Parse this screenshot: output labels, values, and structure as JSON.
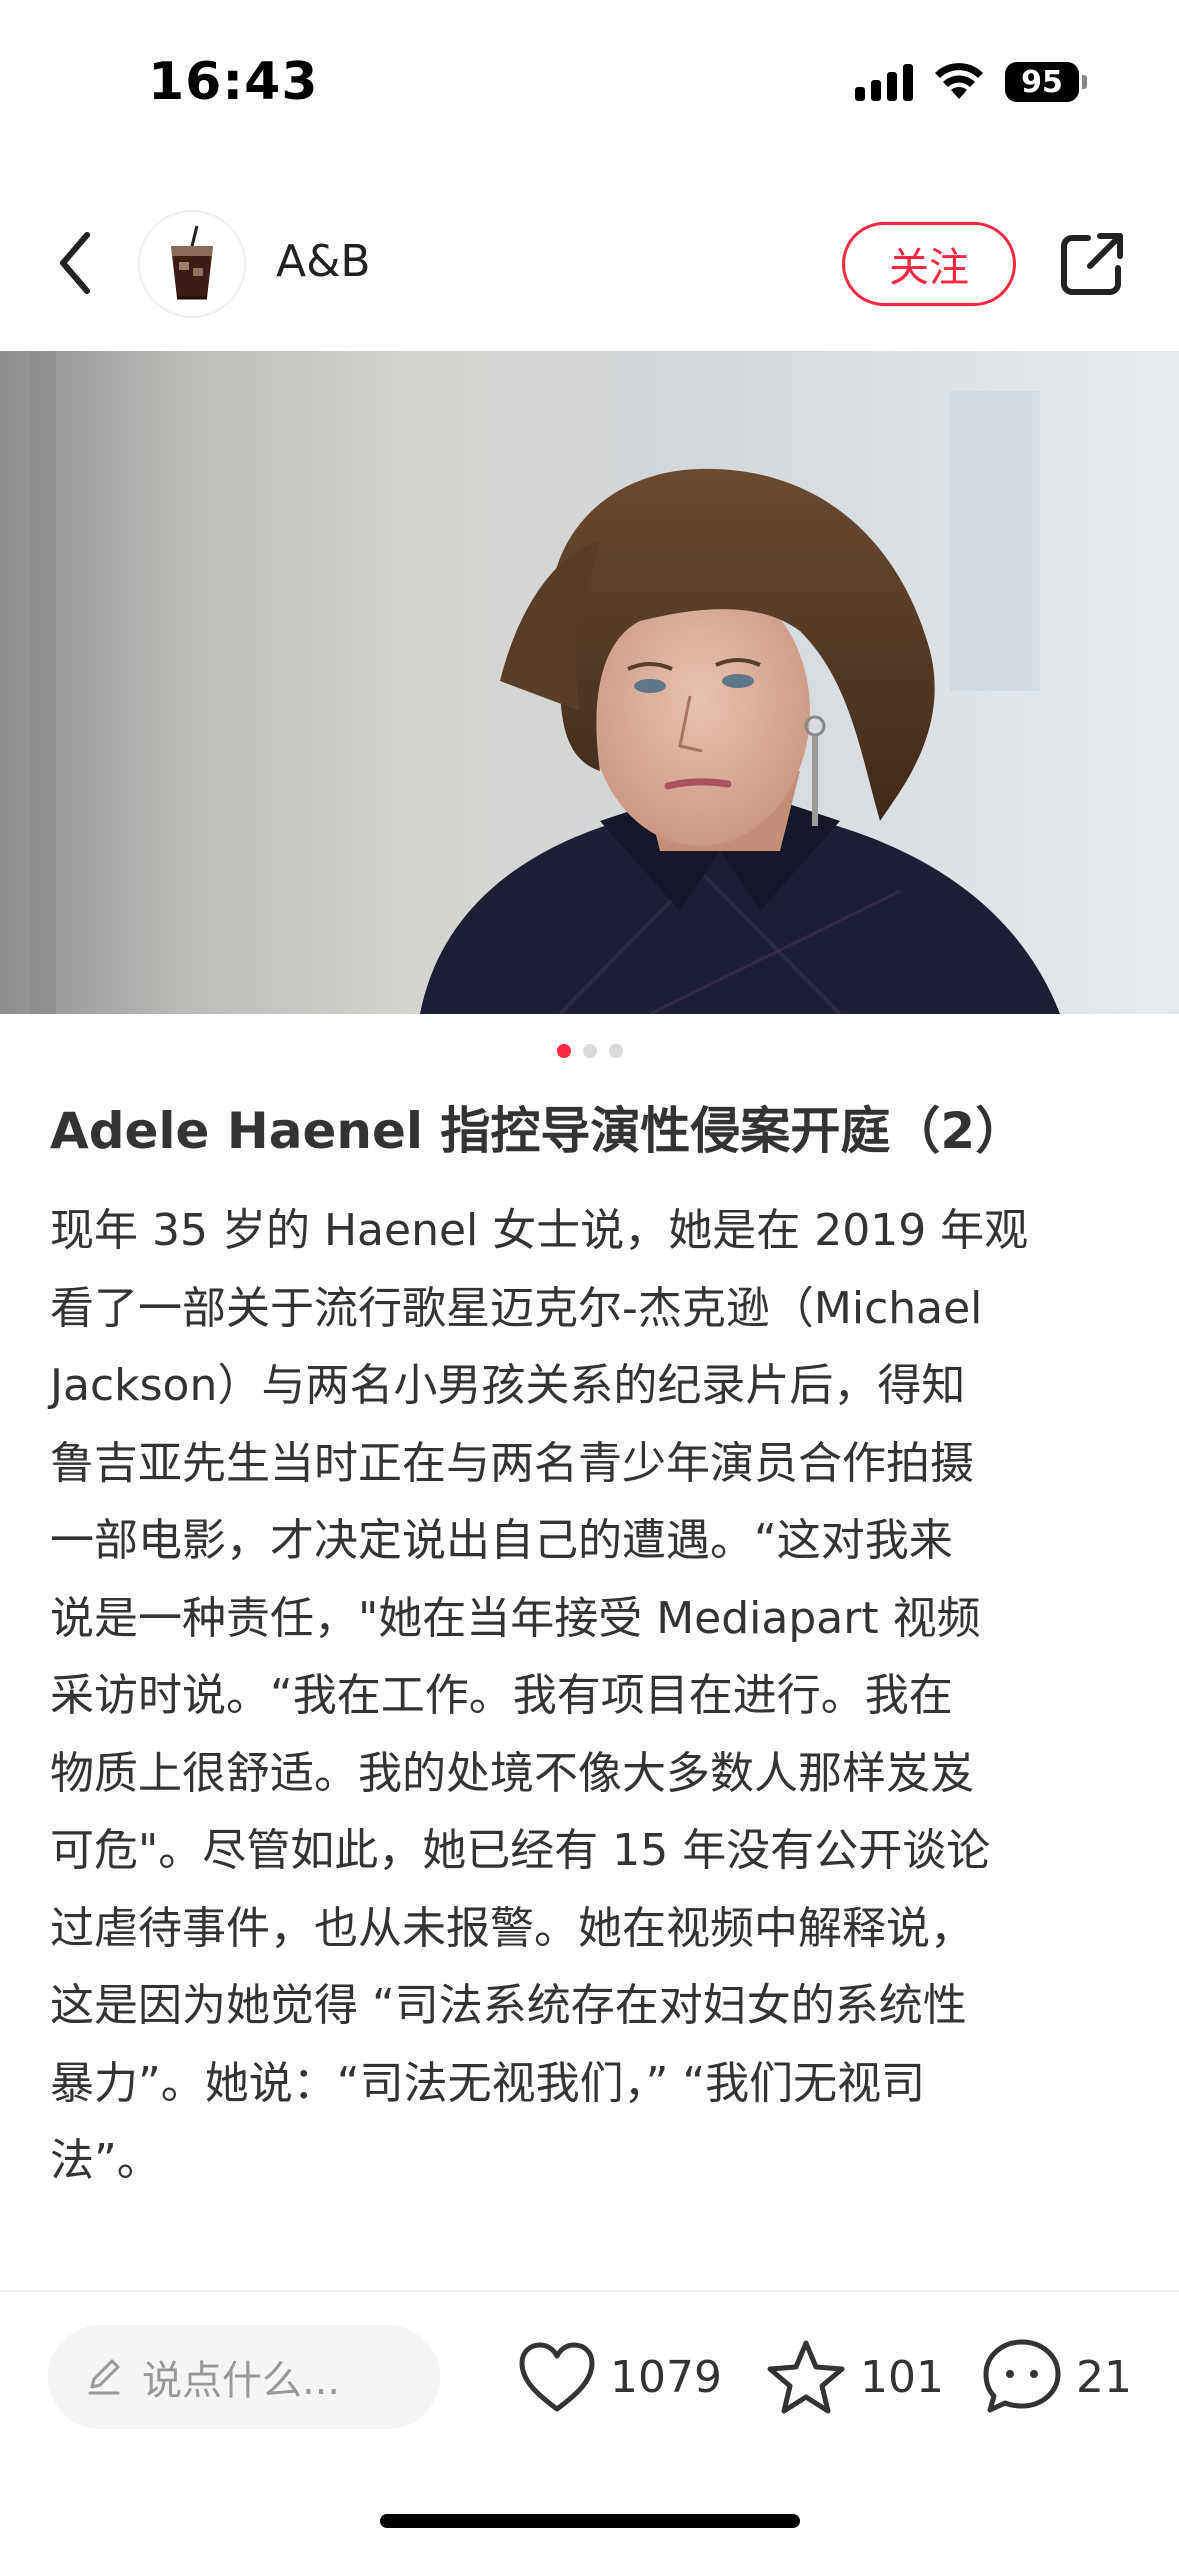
{
  "status_bar": {
    "time": "16:43",
    "battery": "95"
  },
  "header": {
    "author": "A&B",
    "follow_label": "关注",
    "icons": [
      "back-chevron-icon",
      "avatar-iced-drink",
      "share-icon"
    ]
  },
  "post": {
    "image_count": 3,
    "active_image_index": 0,
    "title": "Adele Haenel 指控导演性侵案开庭（2）",
    "body_lines": [
      "现年 35 岁的 Haenel 女士说，她是在 2019 年观",
      "看了一部关于流行歌星迈克尔-杰克逊（Michael",
      "Jackson）与两名小男孩关系的纪录片后，得知",
      "鲁吉亚先生当时正在与两名青少年演员合作拍摄",
      "一部电影，才决定说出自己的遭遇。“这对我来",
      "说是一种责任，\"她在当年接受 Mediapart 视频",
      "采访时说。“我在工作。我有项目在进行。我在",
      "物质上很舒适。我的处境不像大多数人那样岌岌",
      "可危\"。尽管如此，她已经有 15 年没有公开谈论",
      "过虐待事件，也从未报警。她在视频中解释说，",
      "这是因为她觉得 “司法系统存在对妇女的系统性",
      "暴力”。她说：“司法无视我们，” “我们无视司",
      "法”。"
    ]
  },
  "bottom_bar": {
    "comment_placeholder": "说点什么...",
    "likes": "1079",
    "collects": "101",
    "comments": "21"
  },
  "colors": {
    "accent": "#ff2741",
    "text": "#333333",
    "muted": "#999999"
  }
}
